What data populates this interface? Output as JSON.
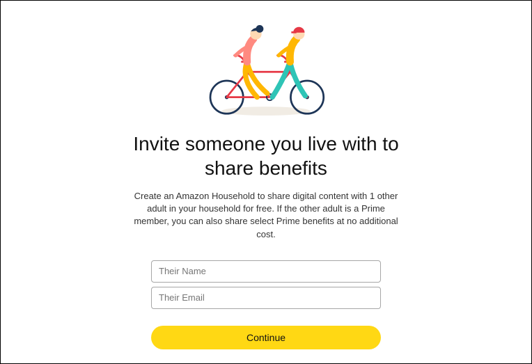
{
  "illustration": {
    "name": "tandem-bike-illustration",
    "colors": {
      "bike": "#e63946",
      "wheels": "#1d3557",
      "person1_top": "#ff8a80",
      "person1_bottom": "#ffb703",
      "person1_hair": "#1d3557",
      "person2_top": "#ffb703",
      "person2_bottom": "#2ec4b6",
      "person2_cap": "#e63946",
      "shadow": "#f1ece4"
    }
  },
  "heading": "Invite someone you live with to share benefits",
  "subtext": "Create an Amazon Household to share digital content with 1 other adult in your household for free. If the other adult is a Prime member, you can also share select Prime benefits at no additional cost.",
  "form": {
    "name_placeholder": "Their Name",
    "email_placeholder": "Their Email",
    "continue_label": "Continue"
  }
}
